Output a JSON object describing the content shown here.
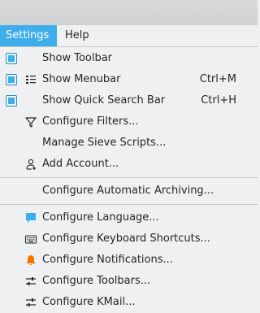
{
  "menubar": {
    "items": [
      {
        "label": "Settings",
        "active": true
      },
      {
        "label": "Help",
        "active": false
      }
    ]
  },
  "settings_menu": {
    "items": [
      {
        "label": "Show Toolbar",
        "checked": true,
        "shortcut": "",
        "icon": ""
      },
      {
        "label": "Show Menubar",
        "checked": true,
        "shortcut": "Ctrl+M",
        "icon": "menubar-icon"
      },
      {
        "label": "Show Quick Search Bar",
        "checked": true,
        "shortcut": "Ctrl+H",
        "icon": ""
      },
      {
        "label": "Configure Filters...",
        "checked": false,
        "shortcut": "",
        "icon": "filter-icon"
      },
      {
        "label": "Manage Sieve Scripts...",
        "checked": false,
        "shortcut": "",
        "icon": ""
      },
      {
        "label": "Add Account...",
        "checked": false,
        "shortcut": "",
        "icon": "add-user-icon"
      },
      {
        "label": "Configure Automatic Archiving...",
        "checked": false,
        "shortcut": "",
        "icon": ""
      },
      {
        "label": "Configure Language...",
        "checked": false,
        "shortcut": "",
        "icon": "language-icon"
      },
      {
        "label": "Configure Keyboard Shortcuts...",
        "checked": false,
        "shortcut": "",
        "icon": "keyboard-icon"
      },
      {
        "label": "Configure Notifications...",
        "checked": false,
        "shortcut": "",
        "icon": "bell-icon"
      },
      {
        "label": "Configure Toolbars...",
        "checked": false,
        "shortcut": "",
        "icon": "configure-icon"
      },
      {
        "label": "Configure KMail...",
        "checked": false,
        "shortcut": "",
        "icon": "configure-icon"
      }
    ]
  },
  "colors": {
    "accent": "#3daee9",
    "background": "#eff0f1",
    "text": "#232627",
    "separator": "#c7c9cb",
    "bell": "#f67400"
  }
}
